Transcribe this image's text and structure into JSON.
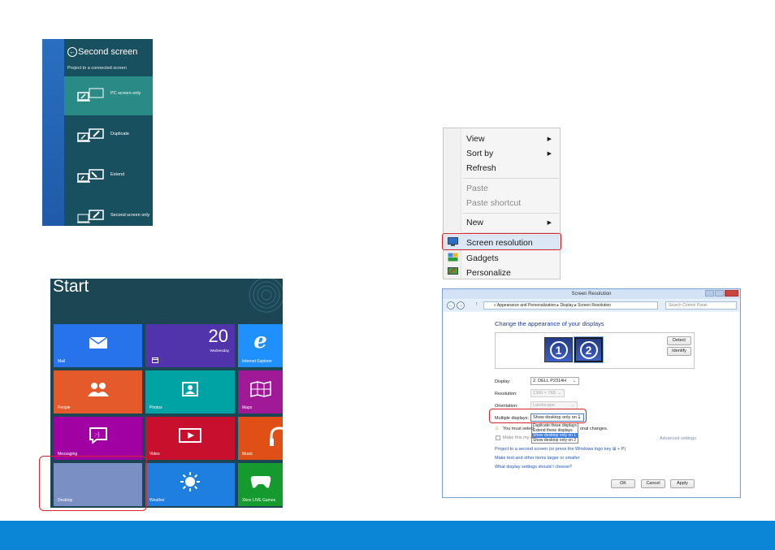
{
  "second_screen": {
    "title": "Second screen",
    "subtitle": "Project to a connected screen",
    "options": [
      {
        "label": "PC screen only",
        "selected": true
      },
      {
        "label": "Duplicate",
        "selected": false
      },
      {
        "label": "Extend",
        "selected": false
      },
      {
        "label": "Second screen only",
        "selected": false
      }
    ]
  },
  "start_screen": {
    "title": "Start",
    "tiles": [
      {
        "label": "Mail",
        "color": "#2673ec",
        "icon": "mail-icon"
      },
      {
        "label": "",
        "color": "#5133ab",
        "icon": "calendar-icon",
        "day": "20",
        "weekday": "Wednesday"
      },
      {
        "label": "Internet Explorer",
        "color": "#1e90ff",
        "icon": "ie-icon"
      },
      {
        "label": "People",
        "color": "#e55a2b",
        "icon": "people-icon"
      },
      {
        "label": "Photos",
        "color": "#00a3a3",
        "icon": "photos-icon"
      },
      {
        "label": "Maps",
        "color": "#a01a98",
        "icon": "maps-icon"
      },
      {
        "label": "Messaging",
        "color": "#a100a3",
        "icon": "messaging-icon"
      },
      {
        "label": "Video",
        "color": "#c8102e",
        "icon": "video-icon"
      },
      {
        "label": "Music",
        "color": "#e04f15",
        "icon": "music-icon"
      },
      {
        "label": "Desktop",
        "color": "#7a8fc3",
        "icon": "desktop-icon"
      },
      {
        "label": "Weather",
        "color": "#1e7fe0",
        "icon": "weather-icon"
      },
      {
        "label": "Xbox LIVE Games",
        "color": "#159a2d",
        "icon": "xbox-icon"
      }
    ]
  },
  "context_menu": {
    "items": [
      {
        "label": "View",
        "submenu": true,
        "disabled": false
      },
      {
        "label": "Sort by",
        "submenu": true,
        "disabled": false
      },
      {
        "label": "Refresh",
        "submenu": false,
        "disabled": false
      },
      {
        "label": "Paste",
        "submenu": false,
        "disabled": true
      },
      {
        "label": "Paste shortcut",
        "submenu": false,
        "disabled": true
      },
      {
        "label": "New",
        "submenu": true,
        "disabled": false
      },
      {
        "label": "Screen resolution",
        "submenu": false,
        "disabled": false,
        "highlighted": true
      },
      {
        "label": "Gadgets",
        "submenu": false,
        "disabled": false
      },
      {
        "label": "Personalize",
        "submenu": false,
        "disabled": false
      }
    ]
  },
  "resolution_window": {
    "title": "Screen Resolution",
    "breadcrumb": "« Appearance and Personalization ▸ Display ▸ Screen Resolution",
    "search_placeholder": "Search Control Panel",
    "heading": "Change the appearance of your displays",
    "monitors": [
      "1",
      "2"
    ],
    "detect_label": "Detect",
    "identify_label": "Identify",
    "display_label": "Display:",
    "display_value": "2. DELL P2314H",
    "resolution_label": "Resolution:",
    "resolution_value": "1366 × 768",
    "orientation_label": "Orientation:",
    "orientation_value": "Landscape",
    "multiple_label": "Multiple displays:",
    "multiple_value": "Show desktop only on 1",
    "multiple_options": [
      "Duplicate these displays",
      "Extend these displays",
      "Show desktop only on 1",
      "Show desktop only on 2"
    ],
    "warning_left": "You must select",
    "warning_right": "onal changes.",
    "make_primary": "Make this my m",
    "advanced": "Advanced settings",
    "links": [
      "Project to a second screen (or press the Windows logo key ⊞ + P)",
      "Make text and other items larger or smaller",
      "What display settings should I choose?"
    ],
    "ok": "OK",
    "cancel": "Cancel",
    "apply": "Apply"
  },
  "colors": {
    "accent_red": "#d9232d",
    "band_blue": "#0b85d6"
  }
}
